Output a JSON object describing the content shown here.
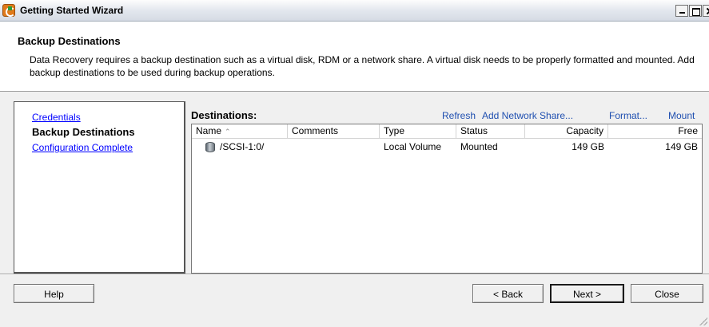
{
  "window": {
    "title": "Getting Started Wizard",
    "controls": [
      "minimize-icon",
      "maximize-icon",
      "close-icon"
    ]
  },
  "header": {
    "title": "Backup Destinations",
    "description": "Data Recovery requires a backup destination such as a virtual disk, RDM or a network share. A virtual disk needs to be properly formatted and mounted.  Add backup destinations to be used during backup operations."
  },
  "steps": [
    {
      "label": "Credentials",
      "state": "link"
    },
    {
      "label": "Backup Destinations",
      "state": "current"
    },
    {
      "label": "Configuration Complete",
      "state": "link"
    }
  ],
  "destinations": {
    "label": "Destinations:",
    "actions": {
      "refresh": "Refresh",
      "add_network_share": "Add Network Share...",
      "format": "Format...",
      "mount": "Mount"
    },
    "columns": {
      "name": "Name",
      "comments": "Comments",
      "type": "Type",
      "status": "Status",
      "capacity": "Capacity",
      "free": "Free"
    },
    "sort_icon": "sort-ascending-icon",
    "rows": [
      {
        "icon": "disk-icon",
        "name": "/SCSI-1:0/",
        "comments": "",
        "type": "Local Volume",
        "status": "Mounted",
        "capacity": "149 GB",
        "free": "149 GB"
      }
    ]
  },
  "buttons": {
    "help": "Help",
    "back": "< Back",
    "next": "Next >",
    "close": "Close"
  }
}
